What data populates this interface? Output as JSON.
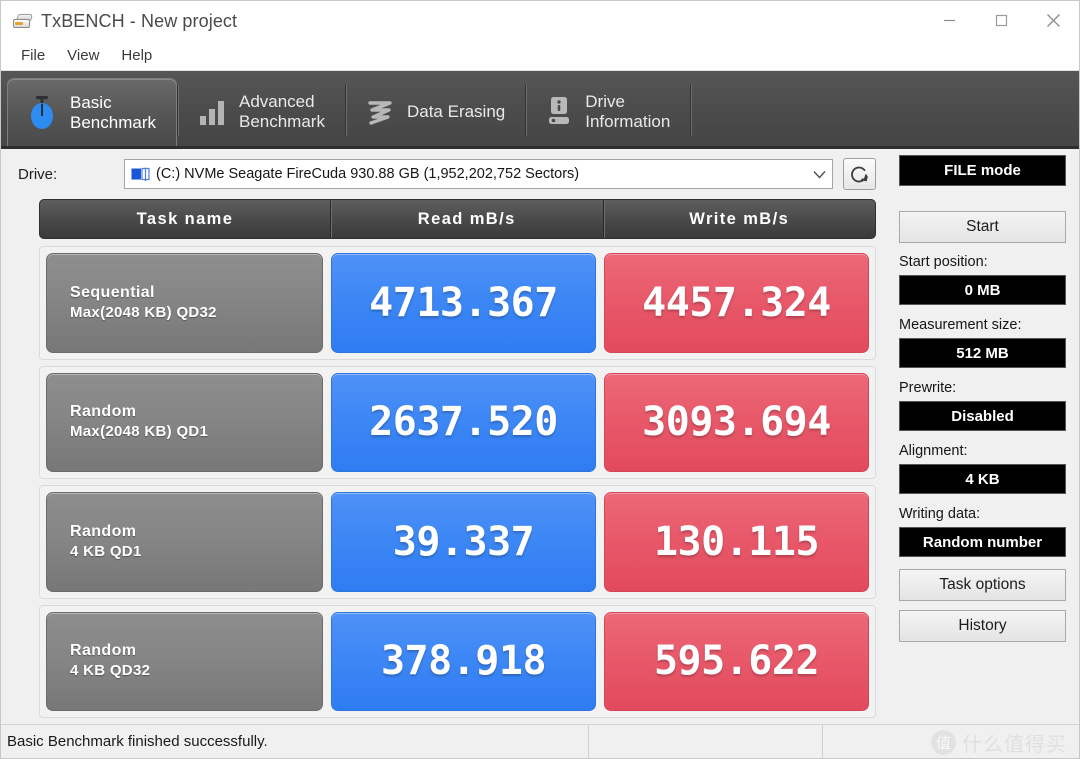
{
  "window": {
    "title": "TxBENCH - New project",
    "icon": "drive-icon",
    "controls": {
      "minimize": "minimize-icon",
      "maximize": "maximize-icon",
      "close": "close-icon"
    }
  },
  "menu": {
    "items": [
      {
        "label": "File"
      },
      {
        "label": "View"
      },
      {
        "label": "Help"
      }
    ]
  },
  "tabs": [
    {
      "label": "Basic\nBenchmark",
      "icon": "stopwatch-icon",
      "active": true
    },
    {
      "label": "Advanced\nBenchmark",
      "icon": "bar-chart-icon",
      "active": false
    },
    {
      "label": "Data Erasing",
      "icon": "scribble-erase-icon",
      "active": false
    },
    {
      "label": "Drive\nInformation",
      "icon": "drive-info-icon",
      "active": false
    }
  ],
  "drive": {
    "label": "Drive:",
    "selected": "(C:) NVMe Seagate FireCuda  930.88 GB (1,952,202,752 Sectors)",
    "icon": "drive-volume-icon",
    "dropdown_icon": "chevron-down-icon",
    "refresh_icon": "refresh-icon"
  },
  "table": {
    "headers": {
      "task": "Task name",
      "read": "Read mB/s",
      "write": "Write mB/s"
    },
    "rows": [
      {
        "task_line1": "Sequential",
        "task_line2": "Max(2048 KB) QD32",
        "read": "4713.367",
        "write": "4457.324"
      },
      {
        "task_line1": "Random",
        "task_line2": "Max(2048 KB) QD1",
        "read": "2637.520",
        "write": "3093.694"
      },
      {
        "task_line1": "Random",
        "task_line2": "4 KB QD1",
        "read": "39.337",
        "write": "130.115"
      },
      {
        "task_line1": "Random",
        "task_line2": "4 KB QD32",
        "read": "378.918",
        "write": "595.622"
      }
    ]
  },
  "sidebar": {
    "mode_label": "FILE mode",
    "start_label": "Start",
    "start_position_label": "Start position:",
    "start_position_value": "0 MB",
    "measurement_size_label": "Measurement size:",
    "measurement_size_value": "512 MB",
    "prewrite_label": "Prewrite:",
    "prewrite_value": "Disabled",
    "alignment_label": "Alignment:",
    "alignment_value": "4 KB",
    "writing_data_label": "Writing data:",
    "writing_data_value": "Random number",
    "task_options_label": "Task options",
    "history_label": "History"
  },
  "status": {
    "message": "Basic Benchmark finished successfully."
  },
  "watermark": {
    "badge": "值",
    "text": "什么值得买"
  },
  "colors": {
    "read_blue": "#3d87f5",
    "write_red": "#e8596a",
    "tab_bar": "#4c4c4c",
    "panel_black": "#000000",
    "app_background": "#f0f0f0"
  }
}
